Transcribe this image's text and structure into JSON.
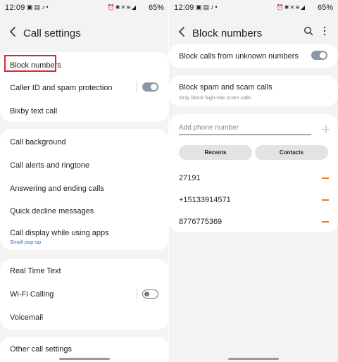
{
  "status_bar": {
    "time": "12:09",
    "battery": "65%",
    "left_icons": [
      "photo-icon",
      "message-icon",
      "music-icon",
      "dot-icon"
    ],
    "right_icons": [
      "alarm-icon",
      "bluetooth-icon",
      "mute-icon",
      "lte-icon",
      "wifi-icon",
      "signal-icon",
      "battery-icon"
    ]
  },
  "left": {
    "title": "Call settings",
    "groups": [
      {
        "items": [
          {
            "label": "Block numbers",
            "highlighted": true
          },
          {
            "label": "Caller ID and spam protection",
            "toggle": "on"
          },
          {
            "label": "Bixby text call"
          }
        ]
      },
      {
        "items": [
          {
            "label": "Call background"
          },
          {
            "label": "Call alerts and ringtone"
          },
          {
            "label": "Answering and ending calls"
          },
          {
            "label": "Quick decline messages"
          },
          {
            "label": "Call display while using apps",
            "sub": "Small pop-up"
          }
        ]
      },
      {
        "items": [
          {
            "label": "Real Time Text"
          },
          {
            "label": "Wi-Fi Calling",
            "toggle": "off"
          },
          {
            "label": "Voicemail"
          }
        ]
      },
      {
        "items": [
          {
            "label": "Other call settings"
          }
        ]
      }
    ]
  },
  "right": {
    "title": "Block numbers",
    "block_unknown": {
      "label": "Block calls from unknown numbers",
      "toggle": "on"
    },
    "spam": {
      "label": "Block spam and scam calls",
      "sub": "Only block high-risk scam calls"
    },
    "input_placeholder": "Add phone number",
    "tabs": [
      "Recents",
      "Contacts"
    ],
    "blocked_numbers": [
      "27191",
      "+15133914571",
      "8776775369"
    ]
  },
  "colors": {
    "accent_orange": "#f07d1a",
    "highlight_red": "#e0262f",
    "link_blue": "#2f6fb5"
  }
}
